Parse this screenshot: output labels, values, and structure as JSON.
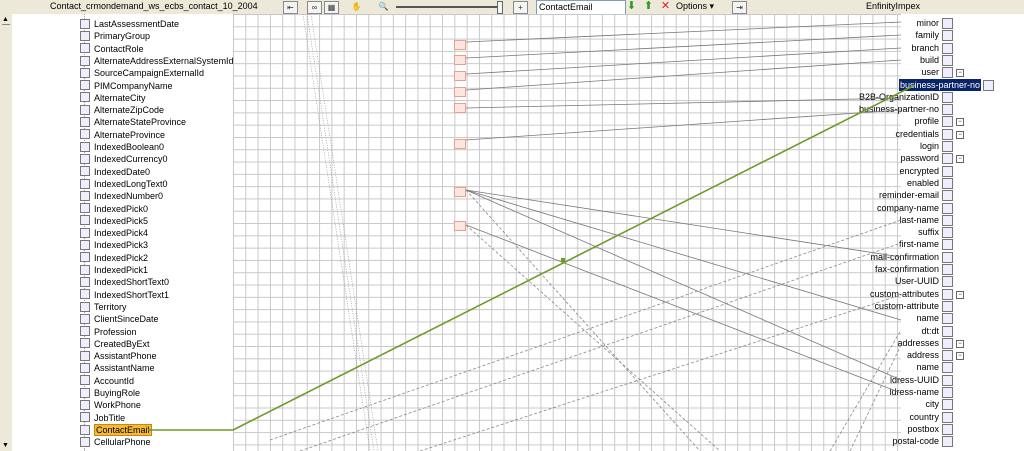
{
  "toolbar": {
    "source_title": "Contact_crmondemand_ws_ecbs_contact_10_2004",
    "target_title": "EnfinityImpex",
    "search_value": "ContactEmail",
    "options_label": "Options"
  },
  "source_fields": [
    "LastAssessmentDate",
    "PrimaryGroup",
    "ContactRole",
    "AlternateAddressExternalSystemId",
    "SourceCampaignExternalId",
    "PIMCompanyName",
    "AlternateCity",
    "AlternateZipCode",
    "AlternateStateProvince",
    "AlternateProvince",
    "IndexedBoolean0",
    "IndexedCurrency0",
    "IndexedDate0",
    "IndexedLongText0",
    "IndexedNumber0",
    "IndexedPick0",
    "IndexedPick5",
    "IndexedPick4",
    "IndexedPick3",
    "IndexedPick2",
    "IndexedPick1",
    "IndexedShortText0",
    "IndexedShortText1",
    "Territory",
    "ClientSinceDate",
    "Profession",
    "CreatedByExt",
    "AssistantPhone",
    "AssistantName",
    "AccountId",
    "BuyingRole",
    "WorkPhone",
    "JobTitle",
    "ContactEmail",
    "CellularPhone"
  ],
  "selected_source": "ContactEmail",
  "target_fields": [
    "minor",
    "family",
    "branch",
    "build",
    "user",
    "business-partner-no",
    "B2B-OrganizationID",
    "business-partner-no",
    "profile",
    "credentials",
    "login",
    "password",
    "encrypted",
    "enabled",
    "reminder-email",
    "company-name",
    "last-name",
    "suffix",
    "first-name",
    "mail-confirmation",
    "fax-confirmation",
    "User-UUID",
    "custom-attributes",
    "custom-attribute",
    "name",
    "dt:dt",
    "addresses",
    "address",
    "name",
    "ldress-UUID",
    "ldress-name",
    "city",
    "country",
    "postbox",
    "postal-code"
  ],
  "selected_target": "business-partner-no"
}
